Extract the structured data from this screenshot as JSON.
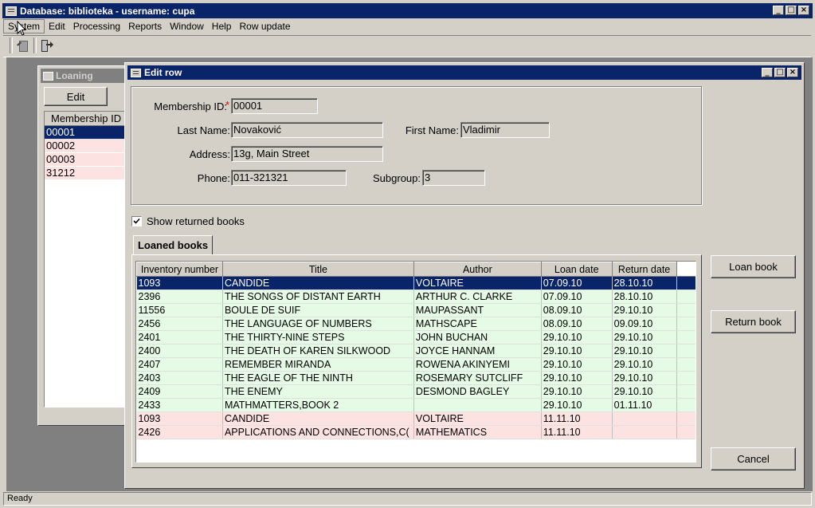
{
  "main_window": {
    "title": "Database: biblioteka  - username: cupa",
    "menu": [
      "System",
      "Edit",
      "Processing",
      "Reports",
      "Window",
      "Help",
      "Row update"
    ],
    "status": "Ready"
  },
  "loaning_window": {
    "title": "Loaning",
    "edit_button": "Edit",
    "column_header": "Membership ID",
    "rows": [
      "00001",
      "00002",
      "00003",
      "31212"
    ]
  },
  "edit_window": {
    "title": "Edit row",
    "fields": {
      "membership_id_label": "Membership ID:",
      "required_mark": "*",
      "membership_id": "00001",
      "last_name_label": "Last Name:",
      "last_name": "Novaković",
      "first_name_label": "First Name:",
      "first_name": "Vladimir",
      "address_label": "Address:",
      "address": "13g, Main Street",
      "phone_label": "Phone:",
      "phone": "011-321321",
      "subgroup_label": "Subgroup:",
      "subgroup": "3"
    },
    "show_returned_label": "Show returned books",
    "show_returned_checked": true,
    "tab_label": "Loaned books",
    "columns": [
      "Inventory number",
      "Title",
      "Author",
      "Loan date",
      "Return date"
    ],
    "rows": [
      [
        "1093",
        "CANDIDE",
        "VOLTAIRE",
        "07.09.10",
        "28.10.10"
      ],
      [
        "2396",
        "THE SONGS OF DISTANT EARTH",
        "ARTHUR C. CLARKE",
        "07.09.10",
        "28.10.10"
      ],
      [
        "11556",
        "BOULE DE SUIF",
        "MAUPASSANT",
        "08.09.10",
        "29.10.10"
      ],
      [
        "2456",
        "THE LANGUAGE OF NUMBERS",
        "MATHSCAPE",
        "08.09.10",
        "09.09.10"
      ],
      [
        "2401",
        "THE THIRTY-NINE STEPS",
        "JOHN BUCHAN",
        "29.10.10",
        "29.10.10"
      ],
      [
        "2400",
        "THE DEATH OF KAREN SILKWOOD",
        "JOYCE HANNAM",
        "29.10.10",
        "29.10.10"
      ],
      [
        "2407",
        "REMEMBER MIRANDA",
        "ROWENA AKINYEMI",
        "29.10.10",
        "29.10.10"
      ],
      [
        "2403",
        "THE EAGLE OF THE NINTH",
        "ROSEMARY SUTCLIFF",
        "29.10.10",
        "29.10.10"
      ],
      [
        "2409",
        "THE ENEMY",
        "DESMOND BAGLEY",
        "29.10.10",
        "29.10.10"
      ],
      [
        "2433",
        "MATHMATTERS,BOOK 2",
        "",
        "29.10.10",
        "01.11.10"
      ],
      [
        "1093",
        "CANDIDE",
        "VOLTAIRE",
        "11.11.10",
        ""
      ],
      [
        "2426",
        "APPLICATIONS AND CONNECTIONS,C(",
        "MATHEMATICS",
        "11.11.10",
        ""
      ]
    ],
    "row_states": [
      "selected",
      "returned",
      "returned",
      "returned",
      "returned",
      "returned",
      "returned",
      "returned",
      "returned",
      "returned",
      "loaned",
      "loaned"
    ],
    "buttons": {
      "loan": "Loan book",
      "return": "Return book",
      "cancel": "Cancel"
    }
  },
  "colors": {
    "title_bar": "#0a246a",
    "inactive_title": "#808080",
    "returned_row": "#e6fbe6",
    "loaned_row": "#fde2e2",
    "selection": "#0a246a"
  },
  "icons": [
    "app-icon",
    "window-icon",
    "toolbar-edit-icon",
    "toolbar-exit-icon",
    "mouse-cursor-icon",
    "checkbox-icon"
  ]
}
